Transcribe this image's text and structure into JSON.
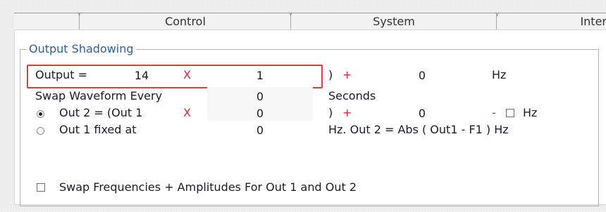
{
  "tabs": [
    {
      "label": "Control"
    },
    {
      "label": "System"
    },
    {
      "label": "Inter"
    }
  ],
  "group": {
    "title": "Output Shadowing"
  },
  "row1": {
    "output_label": "Output =",
    "multiplier_value": "14",
    "times": "X",
    "factor_value": "1",
    "close_plus": ")",
    "plus": "+",
    "offset_value": "0",
    "unit": "Hz"
  },
  "row2": {
    "label": "Swap Waveform Every",
    "value": "0",
    "unit": "Seconds"
  },
  "row3": {
    "label": "Out 2 = (Out 1",
    "times": "X",
    "factor_value": "0",
    "close": ")",
    "plus": "+",
    "offset_value": "0",
    "minus": "-",
    "unit": "Hz",
    "selected": true
  },
  "row4": {
    "label": "Out 1 fixed at",
    "value": "0",
    "formula": "Hz. Out 2 = Abs ( Out1 - F1 ) Hz",
    "selected": false
  },
  "swap": {
    "label": "Swap Frequencies + Amplitudes For Out 1 and Out 2"
  },
  "colors": {
    "accent": "#2b5fa8",
    "highlight": "#e23b3b",
    "operator": "#e0233a"
  }
}
